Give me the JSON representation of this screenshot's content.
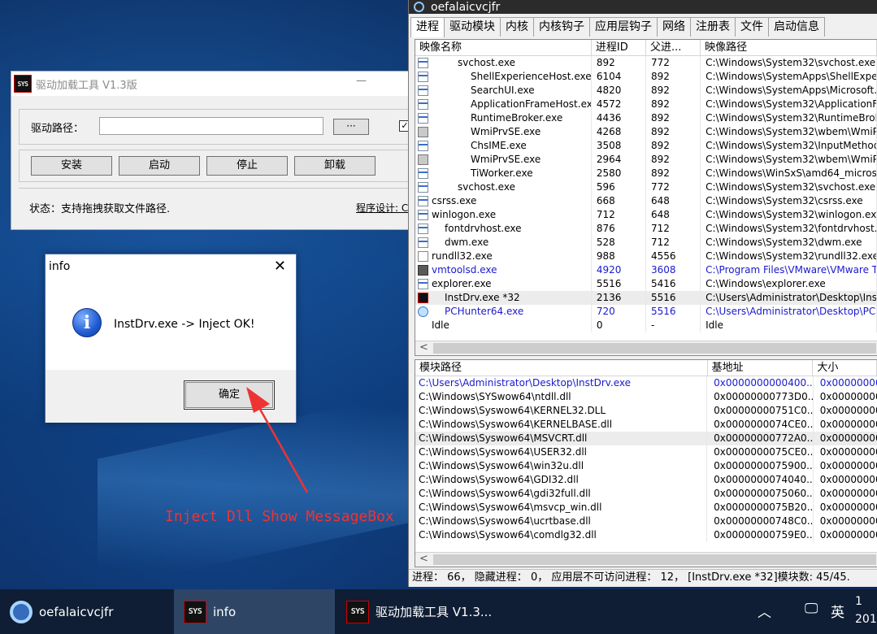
{
  "loader": {
    "title": "驱动加载工具 V1.3版",
    "icon_text": "SYS",
    "minimize": "—",
    "path_label": "驱动路径：",
    "path_value": "",
    "browse_label": "···",
    "checkbox_mark": "✓",
    "buttons": [
      "安装",
      "启动",
      "停止",
      "卸载"
    ],
    "status": "状态：支持拖拽获取文件路径.",
    "designer": "程序设计: C"
  },
  "msgbox": {
    "title": "info",
    "close": "✕",
    "icon": "i",
    "message": "InstDrv.exe -> Inject OK!",
    "ok_label": "确定"
  },
  "annotation": {
    "text": "Inject Dll Show MessageBox",
    "color": "#e33333"
  },
  "hunter": {
    "title": "oefalaicvcjfr",
    "tabs": [
      "进程",
      "驱动模块",
      "内核",
      "内核钩子",
      "应用层钩子",
      "网络",
      "注册表",
      "文件",
      "启动信息"
    ],
    "proc_columns": [
      "映像名称",
      "进程ID",
      "父进...",
      "映像路径"
    ],
    "processes": [
      {
        "name": "svchost.exe",
        "pid": "892",
        "ppid": "772",
        "path": "C:\\Windows\\System32\\svchost.exe",
        "indent": 2,
        "icon": "window-icon"
      },
      {
        "name": "ShellExperienceHost.exe",
        "pid": "6104",
        "ppid": "892",
        "path": "C:\\Windows\\SystemApps\\ShellExperi",
        "indent": 3,
        "icon": "window-icon"
      },
      {
        "name": "SearchUI.exe",
        "pid": "4820",
        "ppid": "892",
        "path": "C:\\Windows\\SystemApps\\Microsoft.W",
        "indent": 3,
        "icon": "window-icon"
      },
      {
        "name": "ApplicationFrameHost.exe",
        "pid": "4572",
        "ppid": "892",
        "path": "C:\\Windows\\System32\\ApplicationFra",
        "indent": 3,
        "icon": "window-icon"
      },
      {
        "name": "RuntimeBroker.exe",
        "pid": "4436",
        "ppid": "892",
        "path": "C:\\Windows\\System32\\RuntimeBroke",
        "indent": 3,
        "icon": "window-icon"
      },
      {
        "name": "WmiPrvSE.exe",
        "pid": "4268",
        "ppid": "892",
        "path": "C:\\Windows\\System32\\wbem\\WmiPr",
        "indent": 3,
        "icon": "gear-icon"
      },
      {
        "name": "ChsIME.exe",
        "pid": "3508",
        "ppid": "892",
        "path": "C:\\Windows\\System32\\InputMethod\\C",
        "indent": 3,
        "icon": "ime-icon"
      },
      {
        "name": "WmiPrvSE.exe",
        "pid": "2964",
        "ppid": "892",
        "path": "C:\\Windows\\System32\\wbem\\WmiPr",
        "indent": 3,
        "icon": "gear-icon"
      },
      {
        "name": "TiWorker.exe",
        "pid": "2580",
        "ppid": "892",
        "path": "C:\\Windows\\WinSxS\\amd64_microsof",
        "indent": 3,
        "icon": "window-icon"
      },
      {
        "name": "svchost.exe",
        "pid": "596",
        "ppid": "772",
        "path": "C:\\Windows\\System32\\svchost.exe",
        "indent": 2,
        "icon": "window-icon"
      },
      {
        "name": "csrss.exe",
        "pid": "668",
        "ppid": "648",
        "path": "C:\\Windows\\System32\\csrss.exe",
        "indent": 0,
        "icon": "window-icon"
      },
      {
        "name": "winlogon.exe",
        "pid": "712",
        "ppid": "648",
        "path": "C:\\Windows\\System32\\winlogon.exe",
        "indent": 0,
        "icon": "window-icon"
      },
      {
        "name": "fontdrvhost.exe",
        "pid": "876",
        "ppid": "712",
        "path": "C:\\Windows\\System32\\fontdrvhost.ex",
        "indent": 1,
        "icon": "window-icon"
      },
      {
        "name": "dwm.exe",
        "pid": "528",
        "ppid": "712",
        "path": "C:\\Windows\\System32\\dwm.exe",
        "indent": 1,
        "icon": "window-icon"
      },
      {
        "name": "rundll32.exe",
        "pid": "988",
        "ppid": "4556",
        "path": "C:\\Windows\\System32\\rundll32.exe",
        "indent": 0,
        "icon": "page-icon"
      },
      {
        "name": "vmtoolsd.exe",
        "pid": "4920",
        "ppid": "3608",
        "path": "C:\\Program Files\\VMware\\VMware To",
        "indent": 0,
        "icon": "vmware-icon",
        "blue": true
      },
      {
        "name": "explorer.exe",
        "pid": "5516",
        "ppid": "5416",
        "path": "C:\\Windows\\explorer.exe",
        "indent": 0,
        "icon": "folder-icon"
      },
      {
        "name": "InstDrv.exe *32",
        "pid": "2136",
        "ppid": "5516",
        "path": "C:\\Users\\Administrator\\Desktop\\InstD",
        "indent": 1,
        "icon": "sys-icon",
        "selected": true
      },
      {
        "name": "PCHunter64.exe",
        "pid": "720",
        "ppid": "5516",
        "path": "C:\\Users\\Administrator\\Desktop\\PCHu",
        "indent": 1,
        "icon": "pchunter-icon",
        "blue": true
      },
      {
        "name": "Idle",
        "pid": "0",
        "ppid": "-",
        "path": "Idle",
        "indent": 0,
        "icon": "none"
      }
    ],
    "mod_columns": [
      "模块路径",
      "基地址",
      "大小"
    ],
    "modules": [
      {
        "path": "C:\\Users\\Administrator\\Desktop\\InstDrv.exe",
        "base": "0x0000000000400...",
        "size": "0x00000000",
        "blue": true
      },
      {
        "path": "C:\\Windows\\SYSwow64\\ntdll.dll",
        "base": "0x00000000773D0...",
        "size": "0x00000000"
      },
      {
        "path": "C:\\Windows\\Syswow64\\KERNEL32.DLL",
        "base": "0x00000000751C0...",
        "size": "0x00000000"
      },
      {
        "path": "C:\\Windows\\Syswow64\\KERNELBASE.dll",
        "base": "0x0000000074CE0...",
        "size": "0x00000000"
      },
      {
        "path": "C:\\Windows\\Syswow64\\MSVCRT.dll",
        "base": "0x00000000772A0...",
        "size": "0x00000000",
        "selected": true
      },
      {
        "path": "C:\\Windows\\Syswow64\\USER32.dll",
        "base": "0x0000000075CE0...",
        "size": "0x00000000"
      },
      {
        "path": "C:\\Windows\\Syswow64\\win32u.dll",
        "base": "0x0000000075900...",
        "size": "0x00000000"
      },
      {
        "path": "C:\\Windows\\Syswow64\\GDI32.dll",
        "base": "0x0000000074040...",
        "size": "0x00000000"
      },
      {
        "path": "C:\\Windows\\Syswow64\\gdi32full.dll",
        "base": "0x0000000075060...",
        "size": "0x00000000"
      },
      {
        "path": "C:\\Windows\\Syswow64\\msvcp_win.dll",
        "base": "0x0000000075B20...",
        "size": "0x00000000"
      },
      {
        "path": "C:\\Windows\\Syswow64\\ucrtbase.dll",
        "base": "0x00000000748C0...",
        "size": "0x00000000"
      },
      {
        "path": "C:\\Windows\\Syswow64\\comdlg32.dll",
        "base": "0x00000000759E0...",
        "size": "0x00000000"
      }
    ],
    "scroll_left": "<",
    "status": "进程： 66， 隐藏进程： 0， 应用层不可访问进程： 12， [InstDrv.exe *32]模块数: 45/45."
  },
  "taskbar": {
    "items": [
      {
        "label": "oefalaicvcjfr",
        "icon": "pchunter-icon",
        "active": false
      },
      {
        "label": "info",
        "icon": "sys-icon",
        "active": true
      },
      {
        "label": "驱动加载工具 V1.3...",
        "icon": "sys-icon",
        "active": false
      }
    ],
    "tray_chevron": "︿",
    "tray_network": "🖵",
    "ime": "英",
    "clock_line1": "1",
    "clock_line2": "201"
  }
}
